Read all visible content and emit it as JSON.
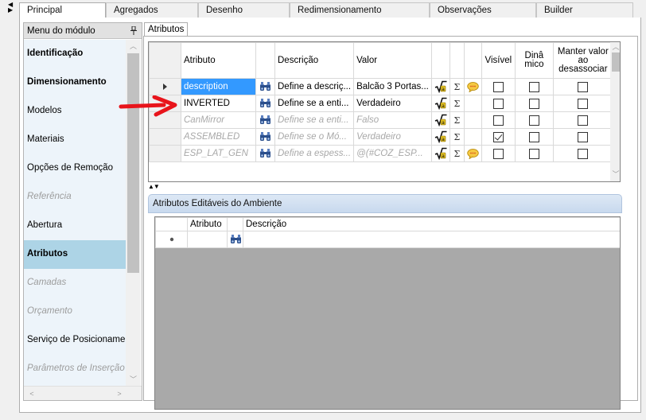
{
  "tabs": [
    "Principal",
    "Agregados",
    "Desenho",
    "Redimensionamento",
    "Observações",
    "Builder"
  ],
  "active_tab": 0,
  "menu": {
    "title": "Menu do módulo",
    "items": [
      {
        "label": "Identificação",
        "style": "bold"
      },
      {
        "label": "Dimensionamento",
        "style": "bold"
      },
      {
        "label": "Modelos",
        "style": "normal"
      },
      {
        "label": "Materiais",
        "style": "normal"
      },
      {
        "label": "Opções de Remoção",
        "style": "normal"
      },
      {
        "label": "Referência",
        "style": "disabled"
      },
      {
        "label": "Abertura",
        "style": "normal"
      },
      {
        "label": "Atributos",
        "style": "selected"
      },
      {
        "label": "Camadas",
        "style": "disabled"
      },
      {
        "label": "Orçamento",
        "style": "disabled"
      },
      {
        "label": "Serviço de Posicionamen",
        "style": "normal"
      },
      {
        "label": "Parâmetros de Inserção",
        "style": "disabled"
      }
    ]
  },
  "subtab": "Atributos",
  "grid": {
    "headers": {
      "attribute": "Atributo",
      "description": "Descrição",
      "value": "Valor",
      "visible": "Visível",
      "dynamic": "Dinâ mico",
      "keep": "Manter valor ao desassociar"
    },
    "rows": [
      {
        "attribute": "description",
        "description": "Define a descriç...",
        "value": "Balcão 3 Portas...",
        "disabled": false,
        "selected": true,
        "current": true,
        "bubble": true,
        "visible": false,
        "dynamic": false,
        "keep": false
      },
      {
        "attribute": "INVERTED",
        "description": "Define se a enti...",
        "value": "Verdadeiro",
        "disabled": false,
        "selected": false,
        "current": false,
        "bubble": false,
        "visible": false,
        "dynamic": false,
        "keep": false
      },
      {
        "attribute": "CanMirror",
        "description": "Define se a enti...",
        "value": "Falso",
        "disabled": true,
        "selected": false,
        "current": false,
        "bubble": false,
        "visible": false,
        "dynamic": false,
        "keep": false
      },
      {
        "attribute": "ASSEMBLED",
        "description": "Define se o Mó...",
        "value": "Verdadeiro",
        "disabled": true,
        "selected": false,
        "current": false,
        "bubble": false,
        "visible": true,
        "dynamic": false,
        "keep": false
      },
      {
        "attribute": "ESP_LAT_GEN",
        "description": "Define a espess...",
        "value": "@(#COZ_ESP...",
        "disabled": true,
        "selected": false,
        "current": false,
        "bubble": true,
        "visible": false,
        "dynamic": false,
        "keep": false
      }
    ],
    "sigma": "Σ"
  },
  "sort_arrows": "▲▼",
  "env": {
    "title": "Atributos Editáveis do Ambiente",
    "headers": {
      "attribute": "Atributo",
      "description": "Descrição"
    }
  },
  "colors": {
    "selection": "#3399ff",
    "menu_selected": "#add4e6",
    "menu_bg": "#edf4fa",
    "annotation": "#e8141b"
  }
}
